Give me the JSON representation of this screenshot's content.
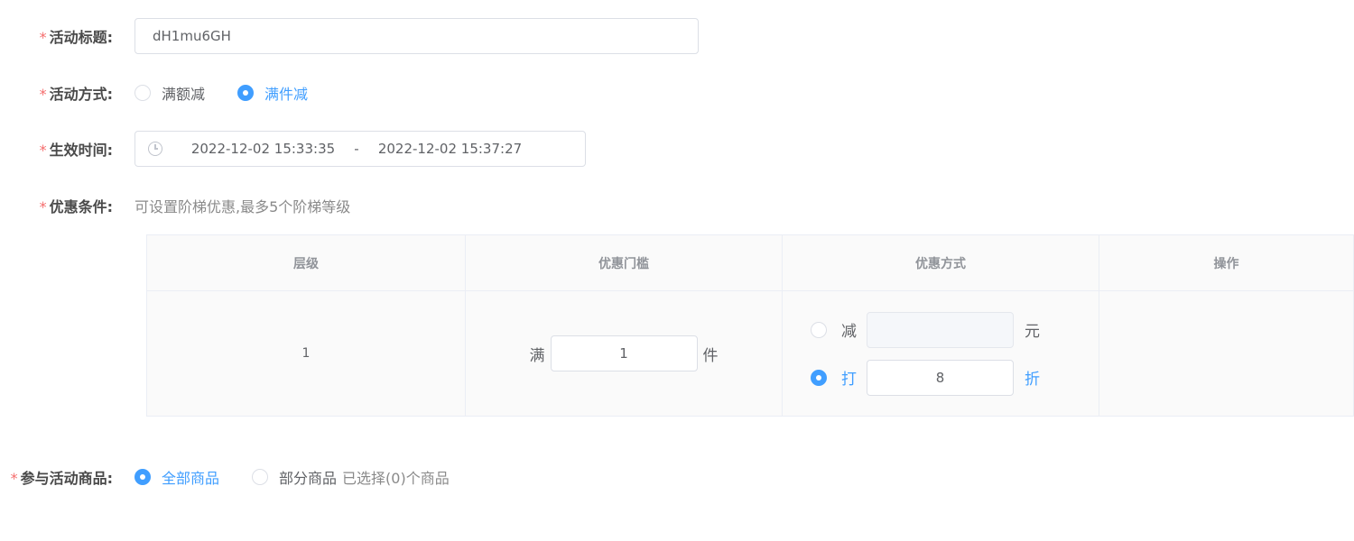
{
  "form": {
    "title": {
      "label": "活动标题:",
      "value": "dH1mu6GH"
    },
    "method": {
      "label": "活动方式:",
      "options": [
        {
          "label": "满额减",
          "checked": false
        },
        {
          "label": "满件减",
          "checked": true
        }
      ]
    },
    "time": {
      "label": "生效时间:",
      "start": "2022-12-02 15:33:35",
      "separator": "-",
      "end": "2022-12-02 15:37:27"
    },
    "conditions": {
      "label": "优惠条件:",
      "hint": "可设置阶梯优惠,最多5个阶梯等级"
    },
    "goods": {
      "label": "参与活动商品:",
      "options": [
        {
          "label": "全部商品",
          "checked": true
        },
        {
          "label": "部分商品",
          "checked": false
        }
      ],
      "selected_text": "已选择(0)个商品"
    }
  },
  "table": {
    "headers": [
      "层级",
      "优惠门槛",
      "优惠方式",
      "操作"
    ],
    "rows": [
      {
        "level": "1",
        "threshold_prefix": "满",
        "threshold_value": "1",
        "threshold_unit": "件",
        "reduce": {
          "label": "减",
          "value": "",
          "unit": "元",
          "checked": false
        },
        "discount": {
          "label": "打",
          "value": "8",
          "unit": "折",
          "checked": true
        }
      }
    ]
  },
  "colors": {
    "accent": "#409eff",
    "required": "#f56c6c"
  }
}
